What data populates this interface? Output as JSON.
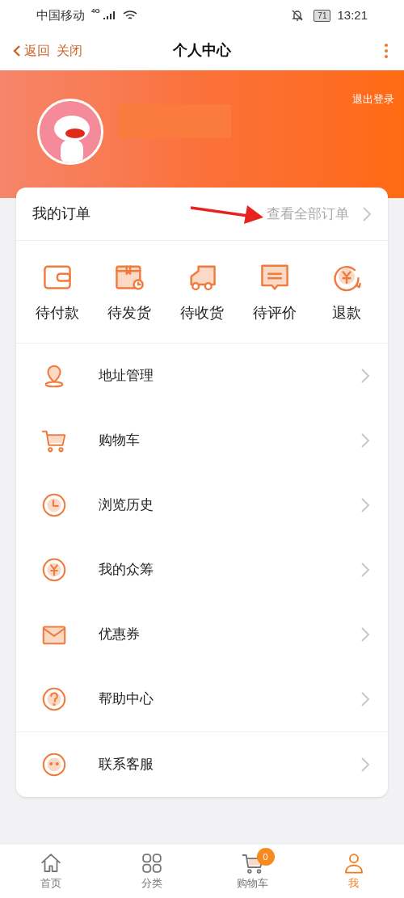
{
  "status_bar": {
    "carrier": "中国移动",
    "network": "4G",
    "battery": "71",
    "time": "13:21"
  },
  "nav": {
    "back": "返回",
    "close": "关闭",
    "title": "个人中心"
  },
  "header": {
    "logout": "退出登录"
  },
  "orders": {
    "title": "我的订单",
    "view_all": "查看全部订单",
    "items": [
      {
        "kind": "wallet",
        "label": "待付款"
      },
      {
        "kind": "box",
        "label": "待发货"
      },
      {
        "kind": "truck",
        "label": "待收货"
      },
      {
        "kind": "comment",
        "label": "待评价"
      },
      {
        "kind": "refund",
        "label": "退款"
      }
    ]
  },
  "menu": [
    {
      "kind": "location",
      "label": "地址管理"
    },
    {
      "kind": "cart",
      "label": "购物车"
    },
    {
      "kind": "clock",
      "label": "浏览历史"
    },
    {
      "kind": "yen",
      "label": "我的众筹"
    },
    {
      "kind": "coupon",
      "label": "优惠券"
    },
    {
      "kind": "help",
      "label": "帮助中心"
    },
    {
      "kind": "service",
      "label": "联系客服"
    }
  ],
  "tabs": [
    {
      "kind": "home",
      "label": "首页",
      "selected": false
    },
    {
      "kind": "grid",
      "label": "分类",
      "selected": false
    },
    {
      "kind": "cart",
      "label": "购物车",
      "selected": false,
      "badge": "0"
    },
    {
      "kind": "user",
      "label": "我",
      "selected": true
    }
  ]
}
